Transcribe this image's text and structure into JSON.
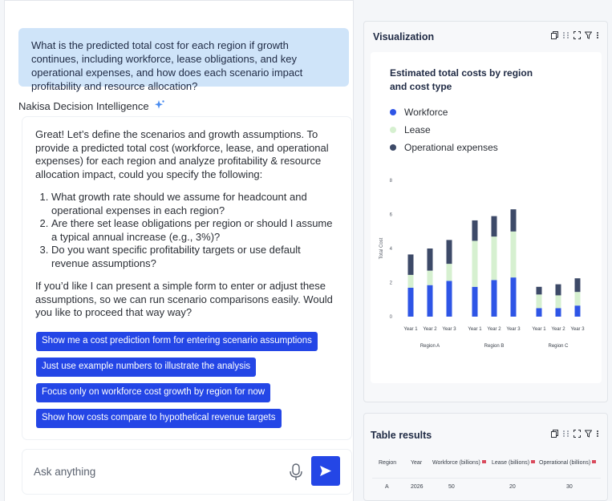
{
  "chat": {
    "user_message": "What is the predicted total cost for each region if growth continues, including workforce, lease obligations, and key operational expenses, and how does each scenario impact profitability and resource allocation?",
    "assistant_name": "Nakisa Decision Intelligence",
    "answer_intro": "Great! Let’s define the scenarios and growth assumptions. To provide a predicted total cost (workforce, lease, and operational expenses) for each region and analyze profitability & resource allocation impact, could you specify the following:",
    "questions": [
      "What growth rate should we assume for headcount and operational expenses in each region?",
      "Are there set lease obligations per region or should I assume a typical annual increase (e.g., 3%)?",
      "Do you want specific profitability targets or use default revenue assumptions?"
    ],
    "answer_outro": "If you’d like I can present a simple form to enter or adjust these assumptions, so we can run scenario comparisons easily. Would you like to proceed that way way?",
    "suggestions": [
      "Show me a cost prediction form for entering scenario assumptions",
      "Just use example numbers to illustrate the analysis",
      "Focus only on workforce cost growth  by region for now",
      "Show how costs compare to hypothetical revenue targets"
    ],
    "input_placeholder": "Ask anything"
  },
  "visualization": {
    "panel_title": "Visualization"
  },
  "chart_data": {
    "type": "bar",
    "stacked": true,
    "title": "Estimated total costs by region and cost type",
    "xlabel": "",
    "ylabel": "Total Cost",
    "ylim": [
      0,
      8
    ],
    "yticks": [
      "0",
      "2",
      "4",
      "6",
      "8"
    ],
    "legend_position": "top-left",
    "categories": [
      "Year 1",
      "Year 2",
      "Year 3",
      "Year 1",
      "Year 2",
      "Year 3",
      "Year 1",
      "Year 2",
      "Year 3"
    ],
    "groups": [
      "Region A",
      "Region B",
      "Region C"
    ],
    "series": [
      {
        "name": "Workforce",
        "color": "#2e55e6",
        "values": [
          1.7,
          1.85,
          2.1,
          1.75,
          2.15,
          2.3,
          0.5,
          0.5,
          0.65
        ]
      },
      {
        "name": "Lease",
        "color": "#d6f0d0",
        "values": [
          0.75,
          0.85,
          1.0,
          2.7,
          2.55,
          2.7,
          0.8,
          0.75,
          0.8
        ]
      },
      {
        "name": "Operational expenses",
        "color": "#3d4a68",
        "values": [
          1.2,
          1.3,
          1.4,
          1.2,
          1.2,
          1.3,
          0.45,
          0.65,
          0.8
        ]
      }
    ]
  },
  "table": {
    "panel_title": "Table results",
    "headers": [
      "Region",
      "Year",
      "Workforce (billions)",
      "Lease (billions)",
      "Operational (billions)"
    ],
    "rows": [
      [
        "A",
        "2026",
        "50",
        "20",
        "30"
      ]
    ]
  },
  "icons": [
    "sparkle-icon",
    "microphone-icon",
    "send-icon",
    "copy-icon",
    "drag-icon",
    "expand-icon",
    "filter-icon",
    "more-icon"
  ],
  "colors": {
    "accent": "#2446e6",
    "user_bubble": "#cfe4f9"
  }
}
